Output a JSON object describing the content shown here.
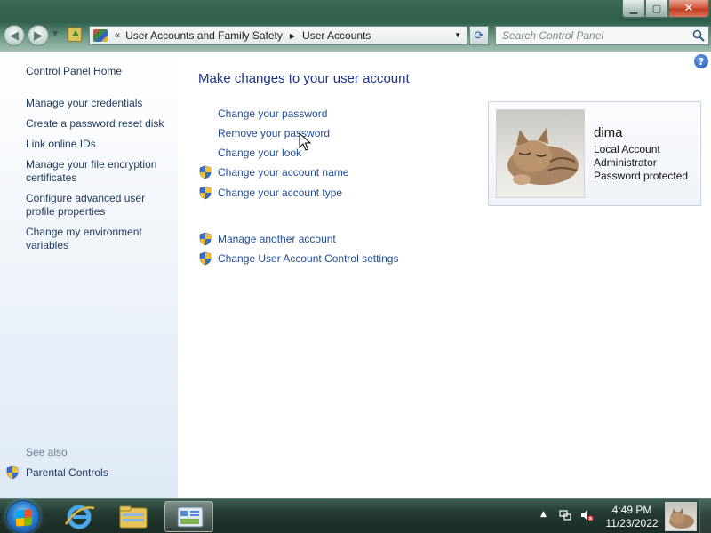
{
  "address": {
    "crumbs": [
      "User Accounts and Family Safety",
      "User Accounts"
    ]
  },
  "search": {
    "placeholder": "Search Control Panel"
  },
  "sidebar": {
    "items": [
      "Control Panel Home",
      "Manage your credentials",
      "Create a password reset disk",
      "Link online IDs",
      "Manage your file encryption certificates",
      "Configure advanced user profile properties",
      "Change my environment variables"
    ],
    "see_also_label": "See also",
    "see_also_items": [
      "Parental Controls"
    ]
  },
  "main": {
    "title": "Make changes to your user account",
    "tasks": [
      {
        "label": "Change your password",
        "shield": false
      },
      {
        "label": "Remove your password",
        "shield": false
      },
      {
        "label": "Change your look",
        "shield": false
      },
      {
        "label": "Change your account name",
        "shield": true
      },
      {
        "label": "Change your account type",
        "shield": true
      }
    ],
    "other_tasks": [
      {
        "label": "Manage another account",
        "shield": true
      },
      {
        "label": "Change User Account Control settings",
        "shield": true
      }
    ]
  },
  "account": {
    "name": "dima",
    "lines": [
      "Local Account",
      "Administrator",
      "Password protected"
    ]
  },
  "taskbar": {
    "time": "4:49 PM",
    "date": "11/23/2022"
  },
  "icons": {
    "help": "help-icon",
    "shield": "uac-shield-icon",
    "search": "search-icon"
  }
}
